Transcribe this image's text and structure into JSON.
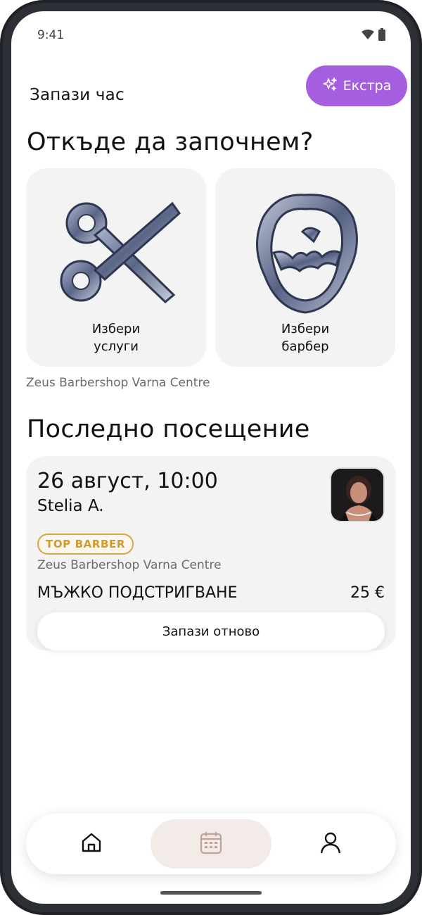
{
  "status_bar": {
    "time": "9:41"
  },
  "header": {
    "title": "Запази час",
    "extra_button_label": "Екстра"
  },
  "start_section": {
    "title": "Откъде да започнем?",
    "cards": [
      {
        "line1": "Избери",
        "line2": "услуги"
      },
      {
        "line1": "Избери",
        "line2": "барбер"
      }
    ],
    "location": "Zeus Barbershop Varna Centre"
  },
  "last_visit": {
    "title": "Последно посещение",
    "date": "26 август, 10:00",
    "barber": "Stelia A.",
    "badge": "TOP BARBER",
    "location": "Zeus Barbershop Varna Centre",
    "service": "МЪЖКО ПОДСТРИГВАНЕ",
    "price": "25 €",
    "rebook_label": "Запази отново"
  },
  "bottom_nav": {
    "items": [
      {
        "icon": "home-icon",
        "active": false
      },
      {
        "icon": "calendar-icon",
        "active": true
      },
      {
        "icon": "profile-icon",
        "active": false
      }
    ]
  },
  "colors": {
    "accent": "#a55ee0",
    "badge": "#d9a641",
    "active_nav": "#f2ebe8"
  }
}
